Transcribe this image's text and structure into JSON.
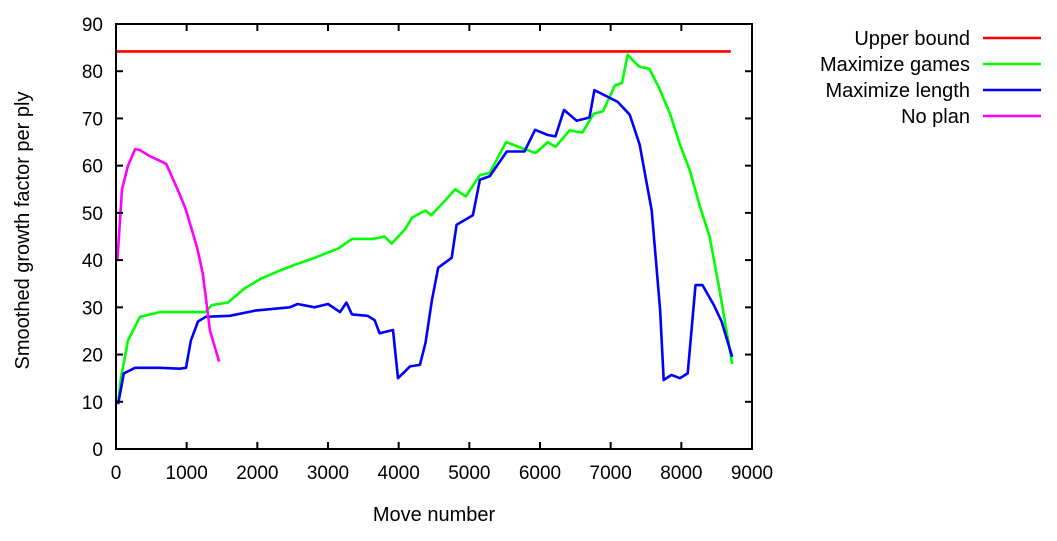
{
  "chart_data": {
    "type": "line",
    "title": "",
    "xlabel": "Move number",
    "ylabel": "Smoothed growth factor per ply",
    "xlim": [
      0,
      9000
    ],
    "ylim": [
      0,
      90
    ],
    "xticks": [
      0,
      1000,
      2000,
      3000,
      4000,
      5000,
      6000,
      7000,
      8000,
      9000
    ],
    "yticks": [
      0,
      10,
      20,
      30,
      40,
      50,
      60,
      70,
      80,
      90
    ],
    "grid": false,
    "legend_position": "outside-top-right",
    "series": [
      {
        "name": "Upper bound",
        "color": "#ff0000",
        "x": [
          0,
          8700
        ],
        "y": [
          84.2,
          84.2
        ]
      },
      {
        "name": "Maximize games",
        "color": "#00ff00",
        "x": [
          30,
          70,
          170,
          340,
          620,
          1260,
          1360,
          1580,
          1820,
          2040,
          2350,
          2530,
          2810,
          3150,
          3340,
          3640,
          3800,
          3900,
          4090,
          4190,
          4380,
          4460,
          4650,
          4800,
          4950,
          5150,
          5290,
          5520,
          5780,
          5940,
          6110,
          6220,
          6420,
          6600,
          6760,
          6890,
          7060,
          7160,
          7240,
          7400,
          7550,
          7700,
          7840,
          7980,
          8120,
          8260,
          8400,
          8540,
          8720
        ],
        "y": [
          9.5,
          15,
          23,
          28,
          29,
          29,
          30.5,
          31,
          34,
          36,
          38,
          39,
          40.5,
          42.5,
          44.5,
          44.5,
          45,
          43.5,
          46.5,
          49,
          50.5,
          49.5,
          52.5,
          55,
          53.5,
          58,
          58.5,
          65,
          63.5,
          62.7,
          65,
          64,
          67.5,
          67,
          71,
          71.5,
          77,
          77.5,
          83.5,
          81,
          80.5,
          76,
          71,
          64.5,
          59,
          51.5,
          45,
          33.7,
          18
        ]
      },
      {
        "name": "Maximize length",
        "color": "#0000ff",
        "x": [
          30,
          110,
          270,
          620,
          900,
          990,
          1060,
          1160,
          1270,
          1610,
          1970,
          2460,
          2570,
          2810,
          3000,
          3170,
          3260,
          3340,
          3560,
          3660,
          3730,
          3920,
          3990,
          4160,
          4300,
          4380,
          4470,
          4560,
          4750,
          4820,
          5050,
          5150,
          5290,
          5530,
          5780,
          5930,
          6110,
          6220,
          6340,
          6520,
          6700,
          6770,
          7100,
          7270,
          7410,
          7580,
          7700,
          7750,
          7860,
          7980,
          8090,
          8200,
          8300,
          8460,
          8570,
          8720
        ],
        "y": [
          9.5,
          16,
          17.2,
          17.2,
          17,
          17.2,
          23,
          27,
          28,
          28.2,
          29.3,
          30,
          30.7,
          30,
          30.7,
          29,
          31,
          28.5,
          28.2,
          27.3,
          24.5,
          25.2,
          15,
          17.5,
          17.8,
          22.5,
          31.5,
          38.4,
          40.5,
          47.5,
          49.5,
          57,
          57.8,
          63,
          63,
          67.6,
          66.5,
          66.2,
          71.8,
          69.5,
          70.2,
          76,
          73.5,
          70.8,
          64.5,
          50.5,
          29.5,
          14.6,
          15.7,
          15,
          16,
          34.7,
          34.7,
          30.5,
          27,
          19.5
        ]
      },
      {
        "name": "No plan",
        "color": "#ff00ff",
        "x": [
          20,
          85,
          170,
          270,
          340,
          480,
          710,
          900,
          990,
          1150,
          1230,
          1330,
          1460
        ],
        "y": [
          40,
          55,
          60,
          63.5,
          63.3,
          62,
          60.4,
          54,
          50.6,
          42.5,
          37,
          25,
          18.5
        ]
      }
    ]
  }
}
